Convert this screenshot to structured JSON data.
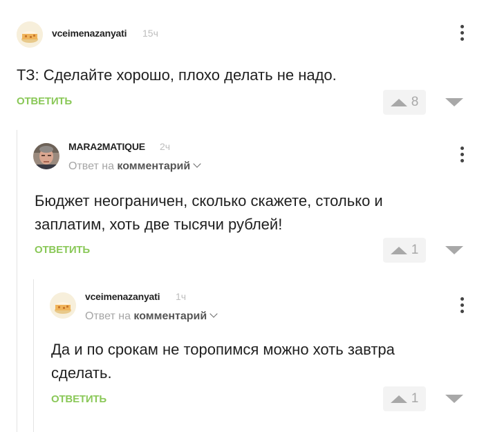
{
  "comments": [
    {
      "username": "vceimenazanyati",
      "time": "15ч",
      "text": "ТЗ: Сделайте хорошо, плохо делать не надо.",
      "reply_label": "ОТВЕТИТЬ",
      "rating": "8",
      "avatar": "cake-avatar"
    },
    {
      "username": "MARA2MATIQUE",
      "time": "2ч",
      "reply_to_prefix": "Ответ на",
      "reply_to_target": "комментарий",
      "text": "Бюджет неограничен, сколько скажете, столько и заплатим, хоть две тысячи рублей!",
      "reply_label": "ОТВЕТИТЬ",
      "rating": "1",
      "avatar": "man-photo-avatar"
    },
    {
      "username": "vceimenazanyati",
      "time": "1ч",
      "reply_to_prefix": "Ответ на",
      "reply_to_target": "комментарий",
      "text": "Да и по срокам не торопимся можно хоть завтра сделать.",
      "reply_label": "ОТВЕТИТЬ",
      "rating": "1",
      "avatar": "cake-avatar"
    }
  ],
  "colors": {
    "accent": "#8ac858",
    "vote_bg": "#f3f3f3",
    "vote_icon": "#a8a8a8"
  },
  "icons": [
    "more-vertical-icon",
    "upvote-icon",
    "downvote-icon",
    "chevron-down-icon"
  ]
}
